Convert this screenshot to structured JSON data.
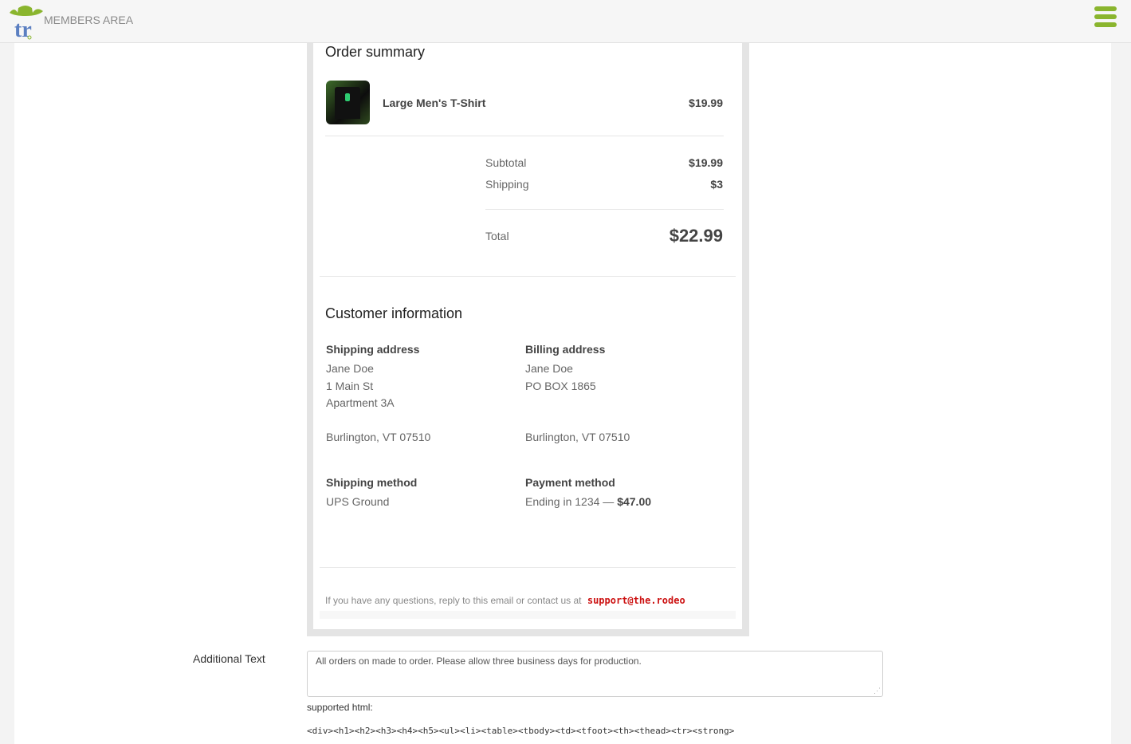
{
  "header": {
    "logo_text": "tr",
    "members_area": "MEMBERS AREA"
  },
  "order_summary": {
    "title": "Order summary",
    "item": {
      "name": "Large Men's T-Shirt",
      "price": "$19.99"
    },
    "subtotal_label": "Subtotal",
    "subtotal_value": "$19.99",
    "shipping_label": "Shipping",
    "shipping_value": "$3",
    "total_label": "Total",
    "total_value": "$22.99"
  },
  "customer_info": {
    "title": "Customer information",
    "shipping_address": {
      "heading": "Shipping address",
      "name": "Jane Doe",
      "line1": "1 Main St",
      "line2": "Apartment 3A",
      "city": "Burlington, VT 07510"
    },
    "billing_address": {
      "heading": "Billing address",
      "name": "Jane Doe",
      "line1": "PO BOX 1865",
      "city": "Burlington, VT 07510"
    },
    "shipping_method": {
      "heading": "Shipping method",
      "value": "UPS Ground"
    },
    "payment_method": {
      "heading": "Payment method",
      "value": "Ending in 1234 —",
      "amount": "$47.00"
    }
  },
  "footer": {
    "note": "If you have any questions, reply to this email or contact us at",
    "email": "support@the.rodeo"
  },
  "form": {
    "additional_text_label": "Additional Text",
    "additional_text_value": "All orders on made to order. Please allow three business days for production.",
    "supported_label": "supported html:",
    "supported_tags": "<div><h1><h2><h3><h4><h5><ul><li><table><tbody><td><tfoot><th><thead><tr><strong>"
  },
  "colors": {
    "brand_green": "#8ab52e",
    "logo_blue": "#5b7fc1",
    "link_red": "#cc1111"
  }
}
